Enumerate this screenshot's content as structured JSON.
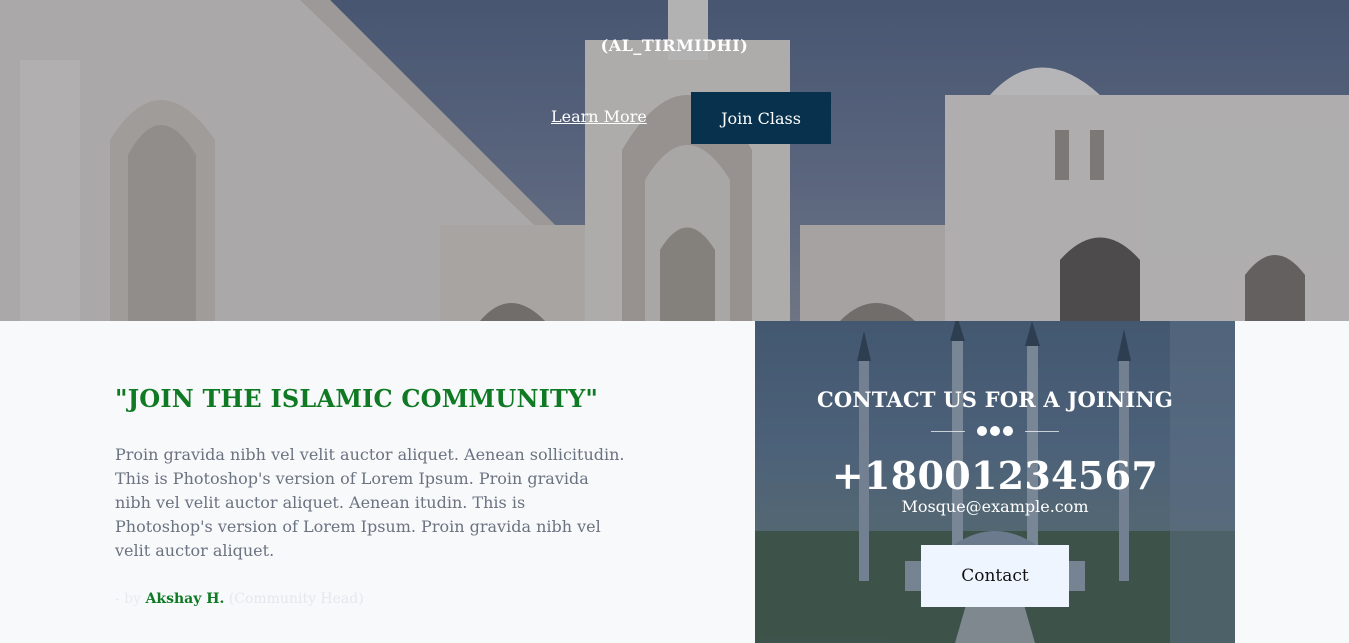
{
  "hero": {
    "subtitle": "(AL_TIRMIDHI)",
    "learn_more_label": "Learn More",
    "join_class_label": "Join Class"
  },
  "community": {
    "heading": "\"JOIN THE ISLAMIC COMMUNITY\"",
    "body": "Proin gravida nibh vel velit auctor aliquet. Aenean sollicitudin. This is Photoshop's version of Lorem Ipsum. Proin gravida nibh vel velit auctor aliquet. Aenean itudin. This is Photoshop's version of Lorem Ipsum. Proin gravida nibh vel velit auctor aliquet.",
    "byline_prefix": "- by ",
    "author": "Akshay H.",
    "role": " (Community Head)"
  },
  "contact": {
    "title": "CONTACT US FOR A JOINING",
    "phone": "+18001234567",
    "email": "Mosque@example.com",
    "button_label": "Contact"
  },
  "colors": {
    "accent_green": "#0f7a23",
    "button_navy": "#07314d",
    "contact_button_bg": "#eef5ff",
    "page_bg": "#f7f9fb"
  }
}
